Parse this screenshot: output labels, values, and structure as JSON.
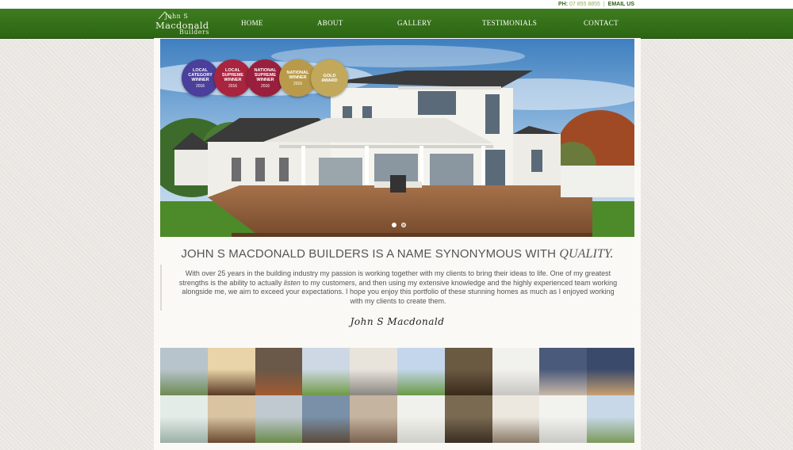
{
  "topbar": {
    "phone_label": "PH:",
    "phone_number": "07 855 8855",
    "separator": "|",
    "email_label": "EMAIL US"
  },
  "logo": {
    "line1": "John S",
    "line2": "Macdonald",
    "line3": "Builders"
  },
  "nav": [
    {
      "label": "HOME"
    },
    {
      "label": "ABOUT"
    },
    {
      "label": "GALLERY"
    },
    {
      "label": "TESTIMONIALS"
    },
    {
      "label": "CONTACT"
    }
  ],
  "hero": {
    "awards": [
      {
        "line1": "LOCAL",
        "line2": "CATEGORY",
        "line3": "WINNER",
        "year": "2016",
        "color": "#4a3f9a"
      },
      {
        "line1": "LOCAL",
        "line2": "SUPREME",
        "line3": "WINNER",
        "year": "2016",
        "color": "#a8243f"
      },
      {
        "line1": "NATIONAL",
        "line2": "SUPREME",
        "line3": "WINNER",
        "year": "2016",
        "color": "#9a1f3c"
      },
      {
        "line1": "NATIONAL",
        "line2": "WINNER",
        "line3": "",
        "year": "2016",
        "color": "#b99a4a"
      },
      {
        "line1": "GOLD",
        "line2": "AWARD",
        "line3": "",
        "year": "",
        "color": "#c2a85a"
      }
    ],
    "slide_count": 2,
    "active_slide": 1
  },
  "intro": {
    "heading_main": "JOHN S MACDONALD BUILDERS IS A NAME SYNONYMOUS WITH",
    "heading_em": "QUALITY.",
    "text_before": "With over 25 years in the building industry my passion is working together with my clients to bring their ideas to life. One of my greatest strengths is the ability to actually",
    "text_em": "listen",
    "text_after": "to my customers, and then using my extensive knowledge and the highly experienced team working alongside me, we aim to exceed your expectations. I hope you enjoy this portfolio of these stunning homes as much as I enjoyed working with my clients to create them.",
    "signature": "John S Macdonald"
  },
  "gallery": {
    "tiles": [
      {
        "top": "#b8c4cc",
        "bottom": "#6d8a52"
      },
      {
        "top": "#e9d3a8",
        "bottom": "#5a3a25"
      },
      {
        "top": "#6a5848",
        "bottom": "#a05a30"
      },
      {
        "top": "#cdd8e4",
        "bottom": "#6f9a45"
      },
      {
        "top": "#e8e4dc",
        "bottom": "#8a8680"
      },
      {
        "top": "#c4d6ec",
        "bottom": "#6a9a46"
      },
      {
        "top": "#6a5a42",
        "bottom": "#3a2a1a"
      },
      {
        "top": "#f1f1ee",
        "bottom": "#c8c6c2"
      },
      {
        "top": "#4a5a7a",
        "bottom": "#c8b8a8"
      },
      {
        "top": "#3a4a6a",
        "bottom": "#c8a070"
      },
      {
        "top": "#e4ece8",
        "bottom": "#9ab0a8"
      },
      {
        "top": "#d8c4a0",
        "bottom": "#6a4a30"
      },
      {
        "top": "#c0c8d0",
        "bottom": "#6a8a4a"
      },
      {
        "top": "#7a90a8",
        "bottom": "#5a4a3a"
      },
      {
        "top": "#c4b4a0",
        "bottom": "#7a6250"
      },
      {
        "top": "#f0f0ec",
        "bottom": "#d0d0ca"
      },
      {
        "top": "#7a6a52",
        "bottom": "#3a2e22"
      },
      {
        "top": "#ece8e0",
        "bottom": "#8a7a68"
      },
      {
        "top": "#f2f2ee",
        "bottom": "#c8c8c4"
      },
      {
        "top": "#c8d8e8",
        "bottom": "#7a9a5a"
      }
    ]
  }
}
